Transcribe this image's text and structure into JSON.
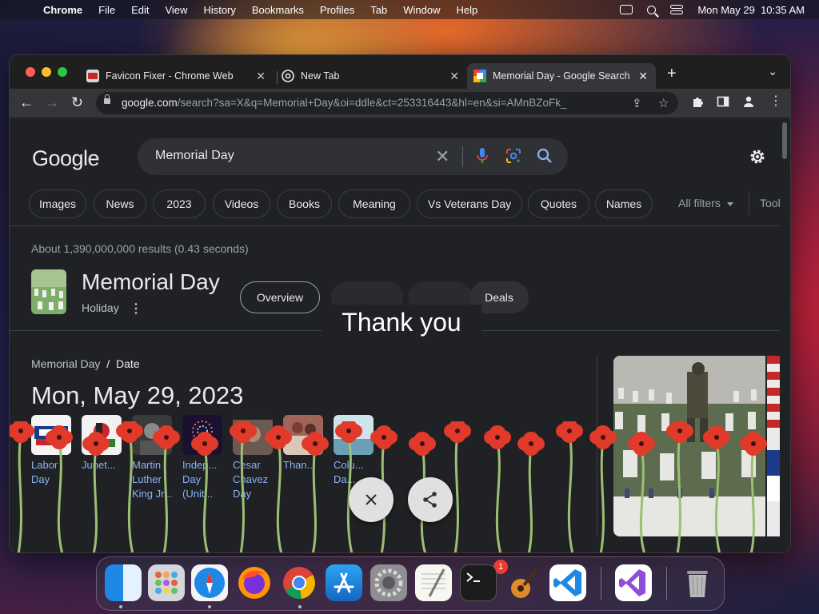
{
  "menubar": {
    "app_name": "Chrome",
    "menus": [
      "File",
      "Edit",
      "View",
      "History",
      "Bookmarks",
      "Profiles",
      "Tab",
      "Window",
      "Help"
    ],
    "datetime": "Mon May 29  10:35 AM"
  },
  "tabs": [
    {
      "title": "Favicon Fixer - Chrome Web",
      "active": false
    },
    {
      "title": "New Tab",
      "active": false
    },
    {
      "title": "Memorial Day - Google Search",
      "active": true
    }
  ],
  "omnibox": {
    "host": "google.com",
    "path": "/search?sa=X&q=Memorial+Day&oi=ddle&ct=253316443&hl=en&si=AMnBZoFk_"
  },
  "search": {
    "logo": "Google",
    "query": "Memorial Day"
  },
  "chips": [
    "Images",
    "News",
    "2023",
    "Videos",
    "Books",
    "Meaning",
    "Vs Veterans Day",
    "Quotes",
    "Names"
  ],
  "filters": {
    "all_filters": "All filters",
    "tools": "Tools"
  },
  "results_stats": "About 1,390,000,000 results (0.43 seconds)",
  "knowledge": {
    "title": "Memorial Day",
    "subtitle": "Holiday",
    "buttons": [
      "Overview",
      "Deals"
    ]
  },
  "doodle_text": "Thank you",
  "date_panel": {
    "breadcrumb_parent": "Memorial Day",
    "breadcrumb_sep": "/",
    "breadcrumb_current": "Date",
    "date": "Mon, May 29, 2023",
    "related": [
      {
        "label": "Labor Day"
      },
      {
        "label": "Junet..."
      },
      {
        "label": "Martin Luther King Jr..."
      },
      {
        "label": "Indep... Day (Unit..."
      },
      {
        "label": "Cesar Chavez Day"
      },
      {
        "label": "Than..."
      },
      {
        "label": "Colu... Da..."
      }
    ]
  },
  "dock": {
    "apps": [
      "finder-icon",
      "launchpad-icon",
      "safari-icon",
      "firefox-icon",
      "chrome-icon",
      "app-store-icon",
      "system-settings-icon",
      "textedit-icon",
      "terminal-icon",
      "garageband-icon",
      "vscode-icon",
      "visual-studio-icon",
      "trash-icon"
    ],
    "settings_badge": "1"
  },
  "colors": {
    "page_bg": "#202124",
    "link": "#8ab4f8",
    "poppy": "#e23a2a"
  }
}
